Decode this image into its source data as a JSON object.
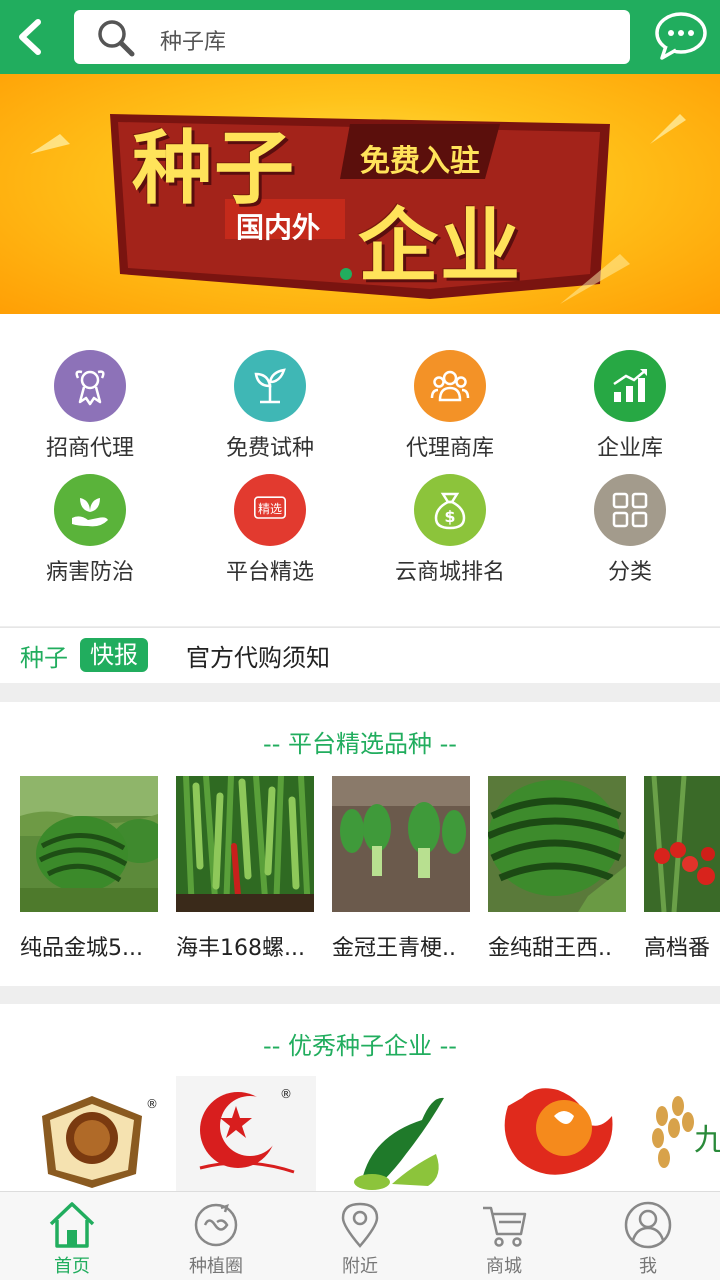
{
  "header": {
    "search_placeholder": "种子库"
  },
  "banner": {
    "big1": "种子",
    "free": "免费入驻",
    "domestic": "国内外",
    "big2": "企业"
  },
  "grid": [
    {
      "label": "招商代理",
      "icon": "ribbon-icon",
      "color": "#8d72b8"
    },
    {
      "label": "免费试种",
      "icon": "sprout-icon",
      "color": "#3fb7b5"
    },
    {
      "label": "代理商库",
      "icon": "people-icon",
      "color": "#f39227"
    },
    {
      "label": "企业库",
      "icon": "bar-chart-icon",
      "color": "#27a844"
    },
    {
      "label": "病害防治",
      "icon": "hand-leaf-icon",
      "color": "#5ab33a"
    },
    {
      "label": "平台精选",
      "icon": "selected-badge-icon",
      "color": "#e23a2f",
      "badge": "精选"
    },
    {
      "label": "云商城排名",
      "icon": "money-bag-icon",
      "color": "#8cc43b"
    },
    {
      "label": "分类",
      "icon": "category-grid-icon",
      "color": "#a39b8c"
    }
  ],
  "news": {
    "tag1": "种子",
    "tag2": "快报",
    "text": "官方代购须知"
  },
  "featured": {
    "title": "-- 平台精选品种 --",
    "items": [
      {
        "name": "纯品金城5..."
      },
      {
        "name": "海丰168螺..."
      },
      {
        "name": "金冠王青梗.."
      },
      {
        "name": "金纯甜王西.."
      },
      {
        "name": "高档番"
      }
    ]
  },
  "companies": {
    "title": "-- 优秀种子企业 --"
  },
  "nav": [
    {
      "label": "首页",
      "icon": "home-icon"
    },
    {
      "label": "种植圈",
      "icon": "circle-icon"
    },
    {
      "label": "附近",
      "icon": "location-icon"
    },
    {
      "label": "商城",
      "icon": "cart-icon"
    },
    {
      "label": "我",
      "icon": "user-icon"
    }
  ],
  "colors": {
    "brand": "#21ad5e"
  }
}
